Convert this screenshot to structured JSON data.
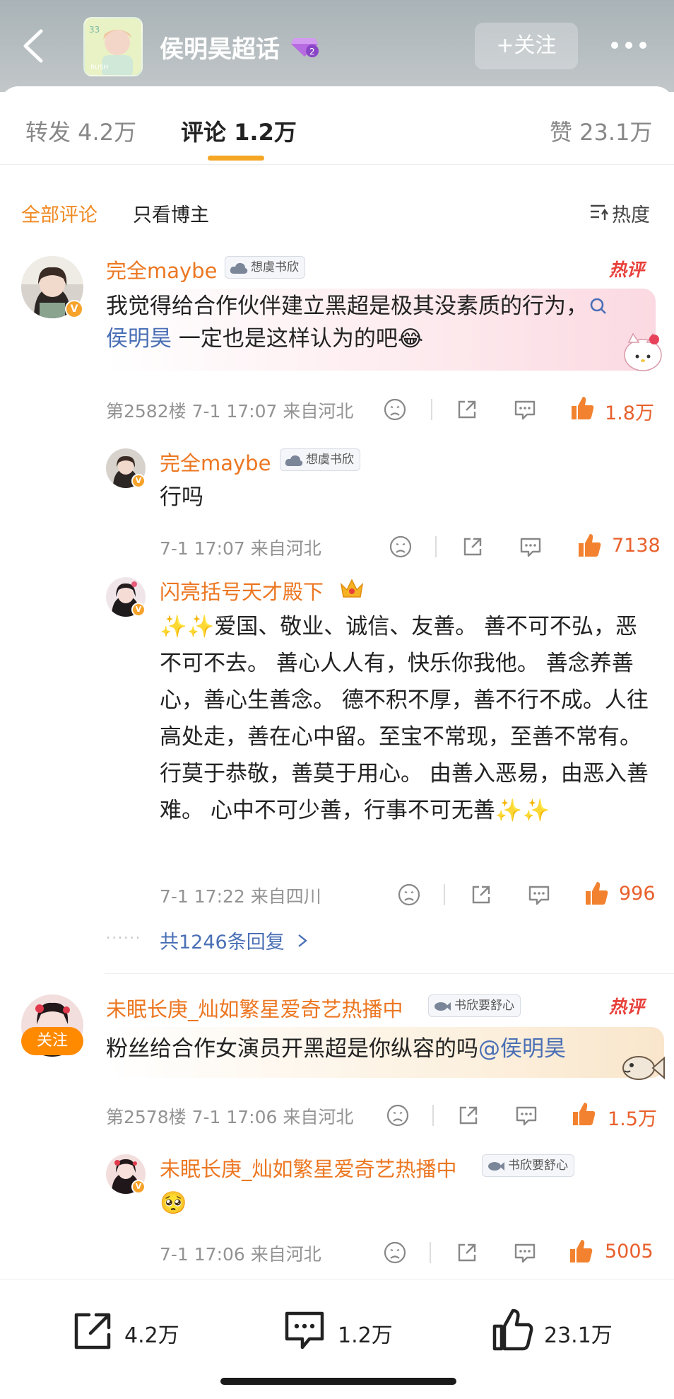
{
  "header": {
    "back": "back",
    "title": "侯明昊超话",
    "follow_label": "+关注",
    "more": "more"
  },
  "tabs": [
    {
      "label": "转发 4.2万"
    },
    {
      "label": "评论 1.2万",
      "active": true
    },
    {
      "label": "赞 23.1万"
    }
  ],
  "filters": {
    "all": "全部评论",
    "author_only": "只看博主",
    "sort": "热度"
  },
  "comments": [
    {
      "user": "完全maybe",
      "fan_badge": "想虞书欣",
      "hot": "热评",
      "text_a": "我觉得给合作伙伴建立黑超是极其没素质的行为，",
      "mention": "侯明昊",
      "text_b": " 一定也是这样认为的吧😂",
      "floor_meta": "第2582楼  7-1 17:07  来自河北",
      "likes": "1.8万",
      "replies": [
        {
          "user": "完全maybe",
          "fan_badge": "想虞书欣",
          "text": "行吗",
          "meta": "7-1 17:07  来自河北",
          "likes": "7138"
        },
        {
          "user": "闪亮括号天才殿下",
          "text": "✨✨爱国、敬业、诚信、友善。 善不可不弘，恶不可不去。 善心人人有，快乐你我他。 善念养善心，善心生善念。 德不积不厚，善不行不成。人往高处走，善在心中留。至宝不常现，至善不常有。 行莫于恭敬，善莫于用心。 由善入恶易，由恶入善难。 心中不可少善，行事不可无善✨✨",
          "meta": "7-1 17:22  来自四川",
          "likes": "996"
        }
      ],
      "reply_total": "共1246条回复"
    },
    {
      "user": "未眠长庚_灿如繁星爱奇艺热播中",
      "fan_badge": "书欣要舒心",
      "hot": "热评",
      "follow_tag": "关注",
      "text_a": "粉丝给合作女演员开黑超是你纵容的吗",
      "mention": "@侯明昊",
      "floor_meta": "第2578楼  7-1 17:06  来自河北",
      "likes": "1.5万",
      "replies": [
        {
          "user": "未眠长庚_灿如繁星爱奇艺热播中",
          "fan_badge": "书欣要舒心",
          "text": "🥺",
          "meta": "7-1 17:06  来自河北",
          "likes": "5005"
        }
      ]
    }
  ],
  "bottom_bar": {
    "repost": "4.2万",
    "comment": "1.2万",
    "like": "23.1万"
  },
  "colors": {
    "accent_orange": "#f08a24",
    "username_orange": "#ec7722",
    "like_orange": "#e8602c",
    "link_blue": "#4a6fb5",
    "hot_red": "#e8403b"
  }
}
